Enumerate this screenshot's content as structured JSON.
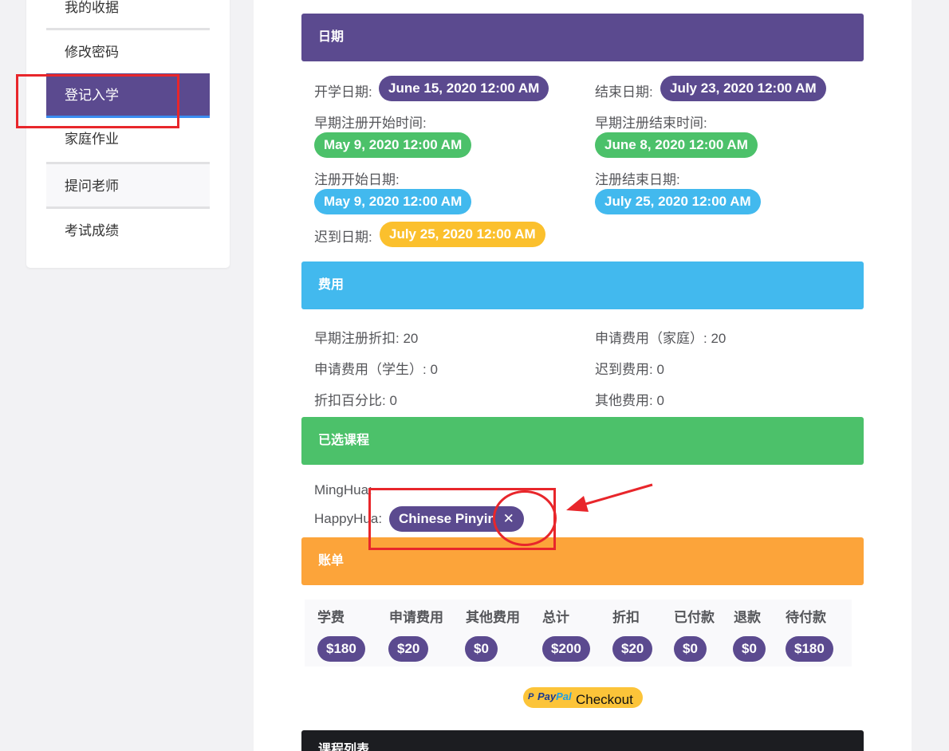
{
  "sidebar": {
    "items": [
      {
        "label": "我的收据"
      },
      {
        "label": "修改密码"
      },
      {
        "label": "登记入学"
      },
      {
        "label": "家庭作业"
      },
      {
        "label": "提问老师"
      },
      {
        "label": "考试成绩"
      }
    ]
  },
  "dates": {
    "header": "日期",
    "start_label": "开学日期:",
    "start_value": "June 15, 2020 12:00 AM",
    "end_label": "结束日期:",
    "end_value": "July 23, 2020 12:00 AM",
    "early_start_label": "早期注册开始时间:",
    "early_start_value": "May 9, 2020 12:00 AM",
    "early_end_label": "早期注册结束时间:",
    "early_end_value": "June 8, 2020 12:00 AM",
    "reg_start_label": "注册开始日期:",
    "reg_start_value": "May 9, 2020 12:00 AM",
    "reg_end_label": "注册结束日期:",
    "reg_end_value": "July 25, 2020 12:00 AM",
    "late_label": "迟到日期:",
    "late_value": "July 25, 2020 12:00 AM"
  },
  "fees": {
    "header": "费用",
    "early_discount": "早期注册折扣: 20",
    "app_fee_family": "申请费用（家庭）: 20",
    "app_fee_student": "申请费用（学生）: 0",
    "late_fee": "迟到费用: 0",
    "discount_percent": "折扣百分比: 0",
    "other_fee": "其他费用: 0"
  },
  "courses": {
    "header": "已选课程",
    "student1": "MingHua:",
    "student2": "HappyHua:",
    "course_pill": "Chinese Pinyin",
    "remove_icon": "✕"
  },
  "bill": {
    "header": "账单",
    "columns": [
      "学费",
      "申请费用",
      "其他费用",
      "总计",
      "折扣",
      "已付款",
      "退款",
      "待付款"
    ],
    "values": [
      "$180",
      "$20",
      "$0",
      "$200",
      "$20",
      "$0",
      "$0",
      "$180"
    ]
  },
  "paypal": {
    "p": "P",
    "pay": "Pay",
    "pal": "Pal",
    "checkout": "Checkout"
  },
  "course_list": {
    "header": "课程列表"
  }
}
